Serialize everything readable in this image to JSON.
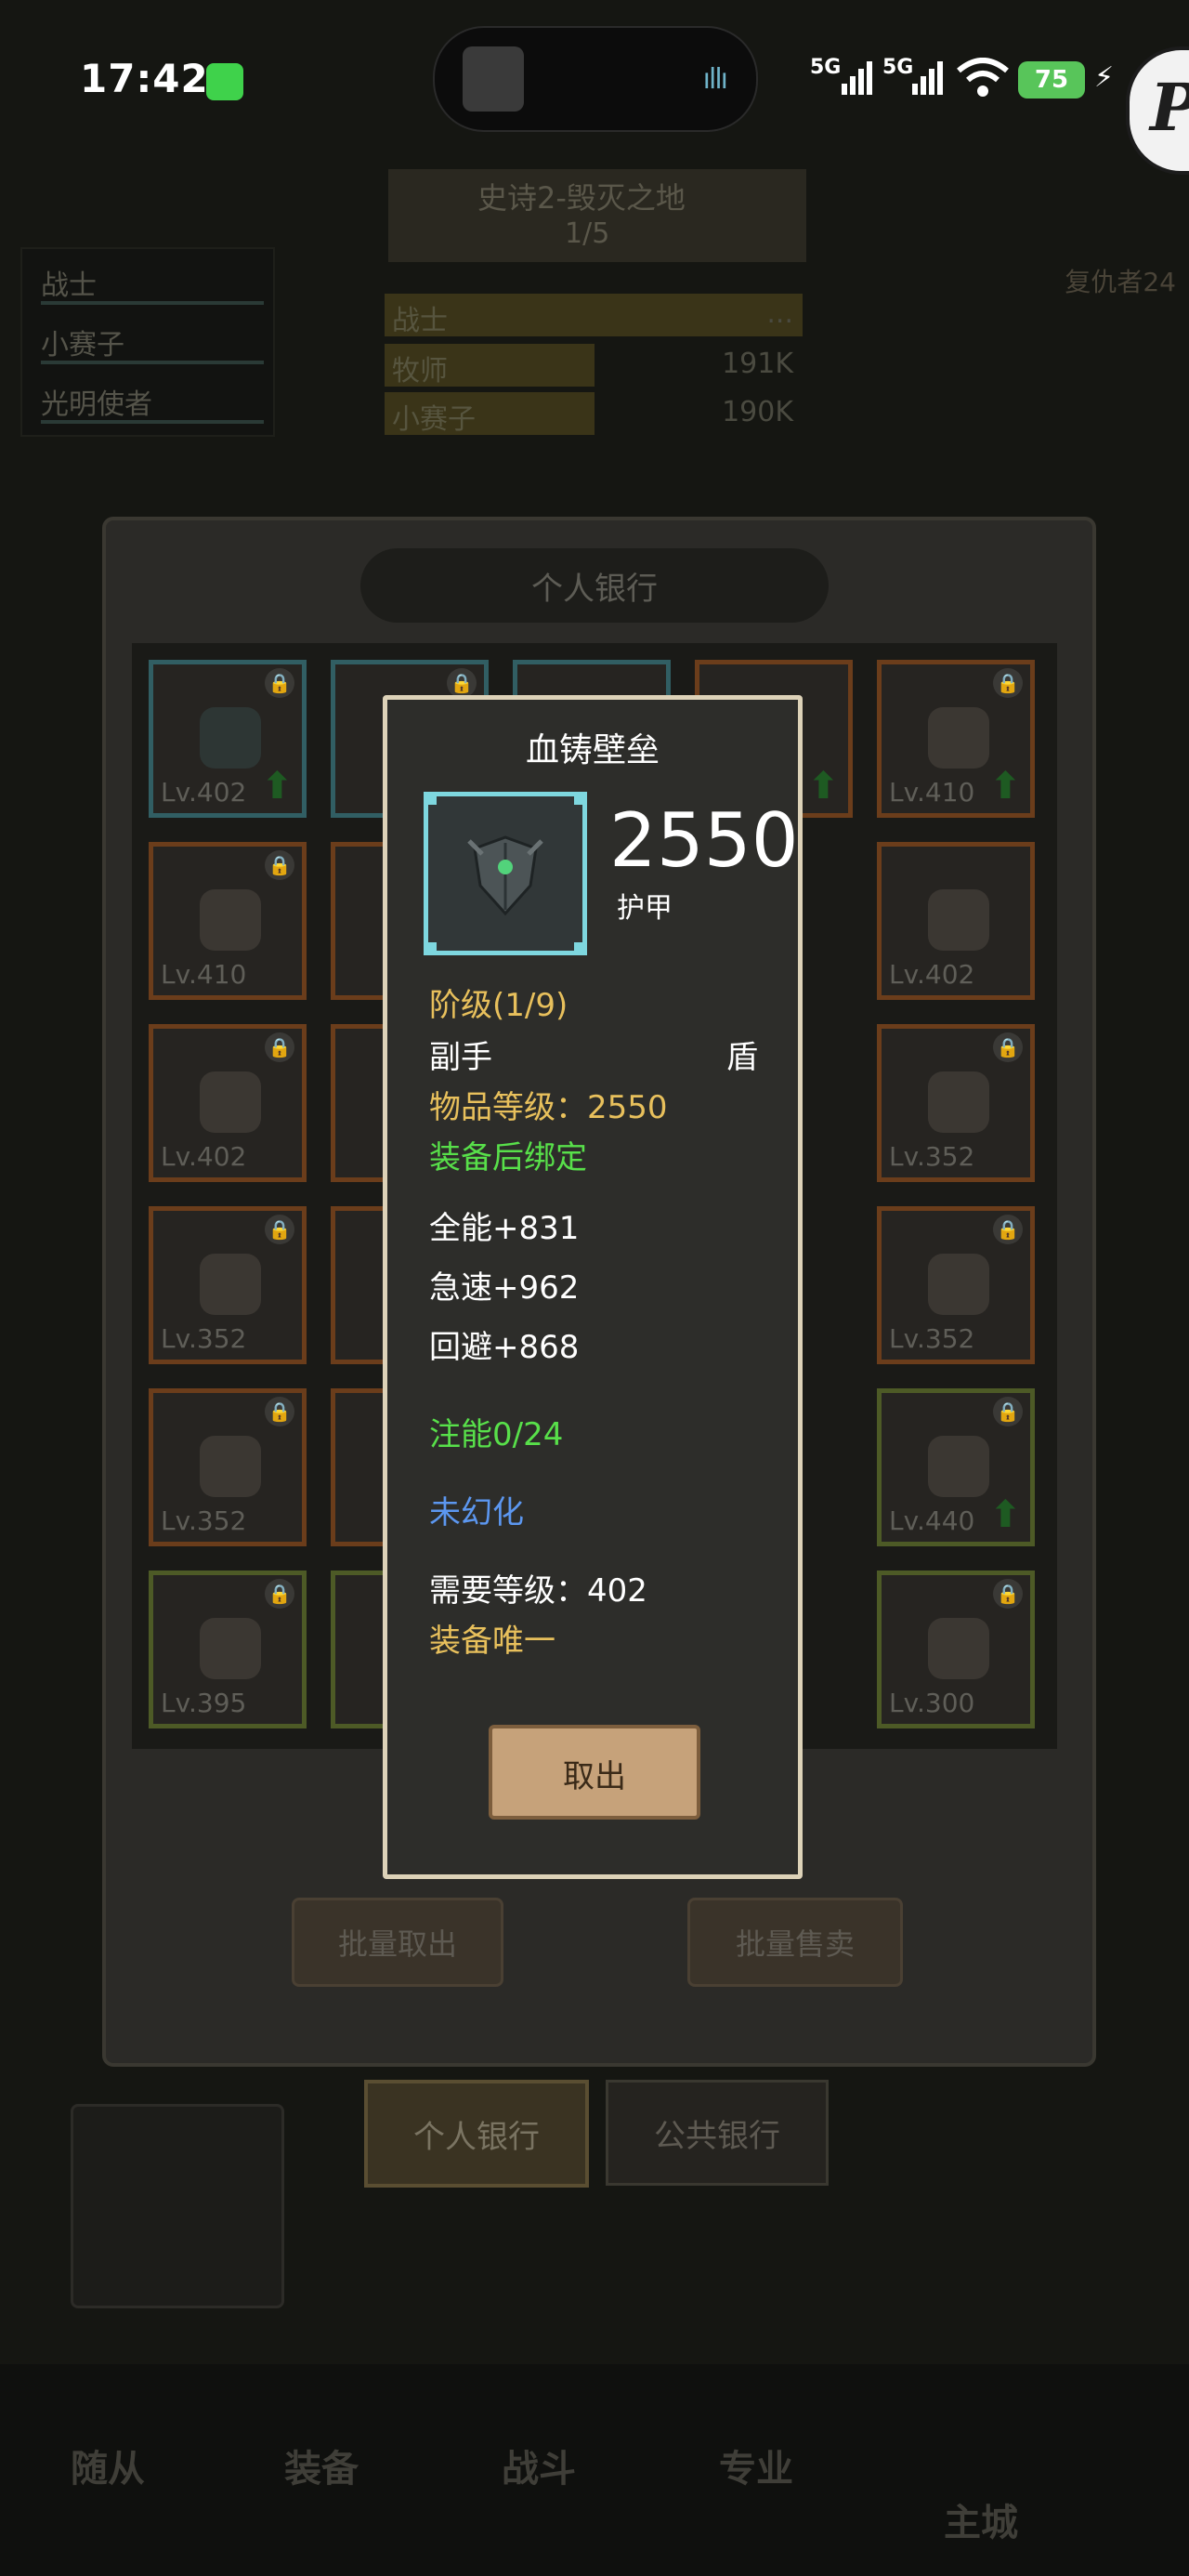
{
  "status_bar": {
    "time": "17:42",
    "signal1": "5G",
    "signal2": "5G",
    "battery": "75"
  },
  "background": {
    "quest_title": "史诗2-毁灭之地",
    "quest_progress": "1/5",
    "dps_rows": [
      {
        "name": "战士",
        "value": "...",
        "fill": 1.0
      },
      {
        "name": "牧师",
        "value": "191K",
        "fill": 0.58
      },
      {
        "name": "小赛子",
        "value": "190K",
        "fill": 0.58
      }
    ],
    "party": [
      "战士",
      "小赛子",
      "光明使者"
    ],
    "enemy_label": "复仇者24",
    "bank_title": "个人银行",
    "slots": [
      {
        "lv": "Lv.402",
        "color": "teal",
        "up": true
      },
      {
        "lv": "Lv.410",
        "color": "orange",
        "up": true
      },
      {
        "lv": "Lv.410",
        "color": "orange",
        "up": false
      },
      {
        "lv": "Lv.402",
        "color": "orange",
        "up": false
      },
      {
        "lv": "Lv.402",
        "color": "orange",
        "up": false
      },
      {
        "lv": "Lv.352",
        "color": "orange",
        "up": false
      },
      {
        "lv": "Lv.352",
        "color": "orange",
        "up": false
      },
      {
        "lv": "Lv.352",
        "color": "orange",
        "up": false
      },
      {
        "lv": "Lv.352",
        "color": "orange",
        "up": false
      },
      {
        "lv": "Lv.440",
        "color": "green",
        "up": true
      },
      {
        "lv": "Lv.395",
        "color": "green",
        "up": false
      },
      {
        "lv": "Lv.300",
        "color": "green",
        "up": false
      }
    ],
    "batch_withdraw": "批量取出",
    "batch_sell": "批量售卖",
    "tab_personal_bank": "个人银行",
    "tab_public_bank": "公共银行",
    "nav": [
      "随从",
      "装备",
      "战斗",
      "专业",
      "主城"
    ]
  },
  "tooltip": {
    "item_name": "血铸壁垒",
    "stat_value": "2550",
    "stat_label": "护甲",
    "tier": "阶级(1/9)",
    "slot": "副手",
    "type": "盾",
    "item_level": "物品等级：2550",
    "bind": "装备后绑定",
    "stats": [
      "全能+831",
      "急速+962",
      "回避+868"
    ],
    "infuse": "注能0/24",
    "transmog": "未幻化",
    "required_level": "需要等级：402",
    "unique": "装备唯一",
    "cancel": "取出"
  }
}
